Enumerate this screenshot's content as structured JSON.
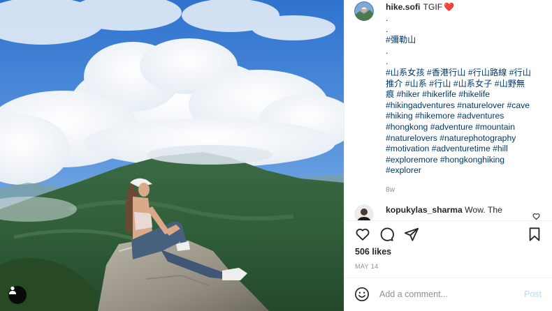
{
  "post": {
    "username": "hike.sofi",
    "caption_first_line": "TGIF",
    "caption_heart": "❤️",
    "caption_dots_a": [
      "."
    ],
    "caption_dots_b": [
      "."
    ],
    "place_tag": "#彌勒山",
    "hashtags": "#山系女孩 #香港行山 #行山路線 #行山推介 #山系 #行山 #山系女子 #山野無痕 #hiker #hikerlife #hikelife #hikingadventures #naturelover #cave #hiking #hikemore #adventures #hongkong #adventure #mountain #naturelovers #naturephotography #motivation #adventuretime #hill #exploremore #hongkonghiking #explorer",
    "time_ago": "8w",
    "likes": "506 likes",
    "date": "MAY 14"
  },
  "comment": {
    "username": "kopukylas_sharma",
    "text": "Wow. The"
  },
  "comment_box": {
    "placeholder": "Add a comment...",
    "post_label": "Post"
  },
  "icons": {
    "like": "heart-outline-icon",
    "comment": "speech-bubble-icon",
    "share": "paper-plane-icon",
    "save": "bookmark-icon",
    "emoji": "smiley-icon",
    "user_tag": "person-icon"
  },
  "colors": {
    "link": "#00376b",
    "muted": "#8e8e8e",
    "post_disabled": "#b3dbff",
    "heart": "#e0245e"
  }
}
